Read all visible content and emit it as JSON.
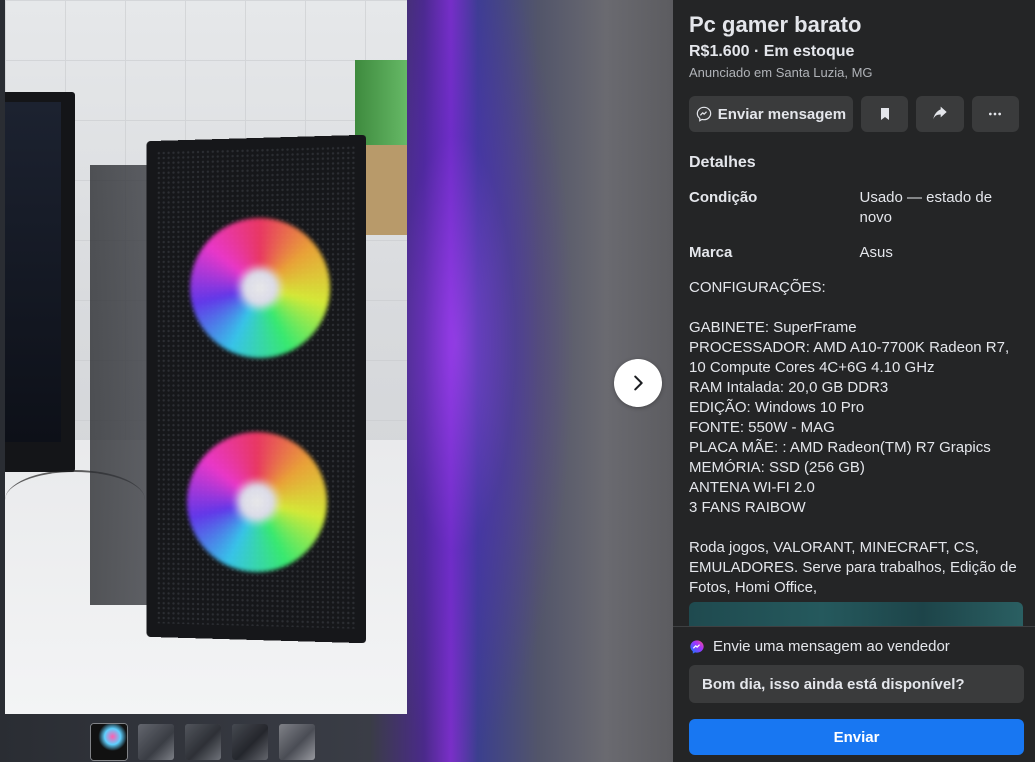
{
  "listing": {
    "title": "Pc gamer barato",
    "price_status": "R$1.600 · Em estoque",
    "location": "Anunciado em Santa Luzia, MG"
  },
  "actions": {
    "message_label": "Enviar mensagem",
    "save_icon": "bookmark-icon",
    "share_icon": "share-icon",
    "more_icon": "more-icon"
  },
  "details": {
    "heading": "Detalhes",
    "rows": [
      {
        "key": "Condição",
        "value": "Usado — estado de novo"
      },
      {
        "key": "Marca",
        "value": "Asus"
      }
    ],
    "description": "CONFIGURAÇÕES:\n\nGABINETE: SuperFrame\nPROCESSADOR: AMD A10-7700K Radeon R7, 10 Compute Cores 4C+6G 4.10 GHz\nRAM Intalada: 20,0 GB DDR3\nEDIÇÃO: Windows 10 Pro\nFONTE: 550W - MAG\nPLACA MÃE: : AMD Radeon(TM) R7 Grapics\nMEMÓRIA: SSD (256 GB)\nANTENA WI-FI 2.0\n3 FANS RAIBOW\n\nRoda jogos, VALORANT, MINECRAFT, CS, EMULADORES. Serve para trabalhos, Edição de Fotos, Homi Office,"
  },
  "seller_message": {
    "heading": "Envie uma mensagem ao vendedor",
    "input_value": "Bom dia, isso ainda está disponível?",
    "send_label": "Enviar"
  },
  "gallery": {
    "next_icon": "chevron-right-icon",
    "thumbnail_count": 5,
    "active_index": 0
  },
  "colors": {
    "panel_bg": "#242526",
    "button_bg": "#3a3b3c",
    "accent": "#1877f2",
    "text_primary": "#e4e6eb",
    "text_secondary": "#b0b3b8"
  }
}
